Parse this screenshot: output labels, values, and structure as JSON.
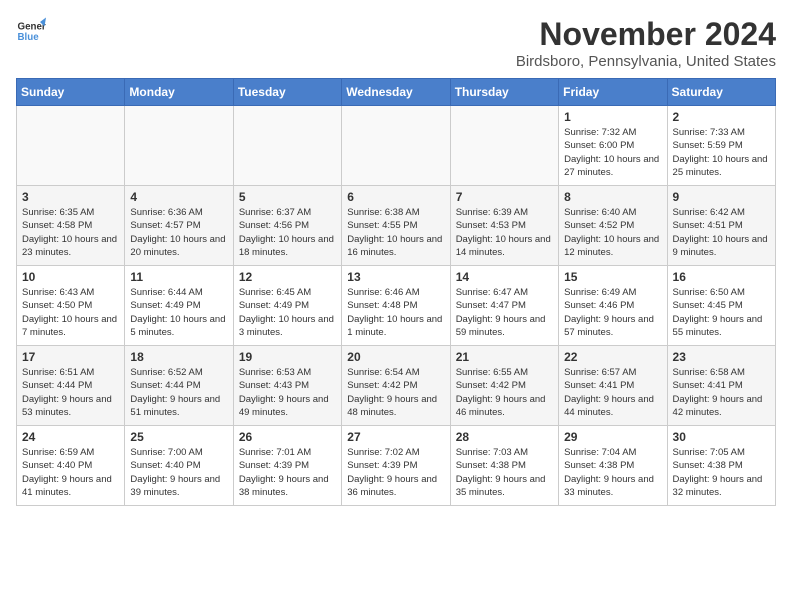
{
  "header": {
    "logo_line1": "General",
    "logo_line2": "Blue",
    "month_title": "November 2024",
    "location": "Birdsboro, Pennsylvania, United States"
  },
  "days_of_week": [
    "Sunday",
    "Monday",
    "Tuesday",
    "Wednesday",
    "Thursday",
    "Friday",
    "Saturday"
  ],
  "weeks": [
    [
      {
        "day": "",
        "info": ""
      },
      {
        "day": "",
        "info": ""
      },
      {
        "day": "",
        "info": ""
      },
      {
        "day": "",
        "info": ""
      },
      {
        "day": "",
        "info": ""
      },
      {
        "day": "1",
        "info": "Sunrise: 7:32 AM\nSunset: 6:00 PM\nDaylight: 10 hours and 27 minutes."
      },
      {
        "day": "2",
        "info": "Sunrise: 7:33 AM\nSunset: 5:59 PM\nDaylight: 10 hours and 25 minutes."
      }
    ],
    [
      {
        "day": "3",
        "info": "Sunrise: 6:35 AM\nSunset: 4:58 PM\nDaylight: 10 hours and 23 minutes."
      },
      {
        "day": "4",
        "info": "Sunrise: 6:36 AM\nSunset: 4:57 PM\nDaylight: 10 hours and 20 minutes."
      },
      {
        "day": "5",
        "info": "Sunrise: 6:37 AM\nSunset: 4:56 PM\nDaylight: 10 hours and 18 minutes."
      },
      {
        "day": "6",
        "info": "Sunrise: 6:38 AM\nSunset: 4:55 PM\nDaylight: 10 hours and 16 minutes."
      },
      {
        "day": "7",
        "info": "Sunrise: 6:39 AM\nSunset: 4:53 PM\nDaylight: 10 hours and 14 minutes."
      },
      {
        "day": "8",
        "info": "Sunrise: 6:40 AM\nSunset: 4:52 PM\nDaylight: 10 hours and 12 minutes."
      },
      {
        "day": "9",
        "info": "Sunrise: 6:42 AM\nSunset: 4:51 PM\nDaylight: 10 hours and 9 minutes."
      }
    ],
    [
      {
        "day": "10",
        "info": "Sunrise: 6:43 AM\nSunset: 4:50 PM\nDaylight: 10 hours and 7 minutes."
      },
      {
        "day": "11",
        "info": "Sunrise: 6:44 AM\nSunset: 4:49 PM\nDaylight: 10 hours and 5 minutes."
      },
      {
        "day": "12",
        "info": "Sunrise: 6:45 AM\nSunset: 4:49 PM\nDaylight: 10 hours and 3 minutes."
      },
      {
        "day": "13",
        "info": "Sunrise: 6:46 AM\nSunset: 4:48 PM\nDaylight: 10 hours and 1 minute."
      },
      {
        "day": "14",
        "info": "Sunrise: 6:47 AM\nSunset: 4:47 PM\nDaylight: 9 hours and 59 minutes."
      },
      {
        "day": "15",
        "info": "Sunrise: 6:49 AM\nSunset: 4:46 PM\nDaylight: 9 hours and 57 minutes."
      },
      {
        "day": "16",
        "info": "Sunrise: 6:50 AM\nSunset: 4:45 PM\nDaylight: 9 hours and 55 minutes."
      }
    ],
    [
      {
        "day": "17",
        "info": "Sunrise: 6:51 AM\nSunset: 4:44 PM\nDaylight: 9 hours and 53 minutes."
      },
      {
        "day": "18",
        "info": "Sunrise: 6:52 AM\nSunset: 4:44 PM\nDaylight: 9 hours and 51 minutes."
      },
      {
        "day": "19",
        "info": "Sunrise: 6:53 AM\nSunset: 4:43 PM\nDaylight: 9 hours and 49 minutes."
      },
      {
        "day": "20",
        "info": "Sunrise: 6:54 AM\nSunset: 4:42 PM\nDaylight: 9 hours and 48 minutes."
      },
      {
        "day": "21",
        "info": "Sunrise: 6:55 AM\nSunset: 4:42 PM\nDaylight: 9 hours and 46 minutes."
      },
      {
        "day": "22",
        "info": "Sunrise: 6:57 AM\nSunset: 4:41 PM\nDaylight: 9 hours and 44 minutes."
      },
      {
        "day": "23",
        "info": "Sunrise: 6:58 AM\nSunset: 4:41 PM\nDaylight: 9 hours and 42 minutes."
      }
    ],
    [
      {
        "day": "24",
        "info": "Sunrise: 6:59 AM\nSunset: 4:40 PM\nDaylight: 9 hours and 41 minutes."
      },
      {
        "day": "25",
        "info": "Sunrise: 7:00 AM\nSunset: 4:40 PM\nDaylight: 9 hours and 39 minutes."
      },
      {
        "day": "26",
        "info": "Sunrise: 7:01 AM\nSunset: 4:39 PM\nDaylight: 9 hours and 38 minutes."
      },
      {
        "day": "27",
        "info": "Sunrise: 7:02 AM\nSunset: 4:39 PM\nDaylight: 9 hours and 36 minutes."
      },
      {
        "day": "28",
        "info": "Sunrise: 7:03 AM\nSunset: 4:38 PM\nDaylight: 9 hours and 35 minutes."
      },
      {
        "day": "29",
        "info": "Sunrise: 7:04 AM\nSunset: 4:38 PM\nDaylight: 9 hours and 33 minutes."
      },
      {
        "day": "30",
        "info": "Sunrise: 7:05 AM\nSunset: 4:38 PM\nDaylight: 9 hours and 32 minutes."
      }
    ]
  ]
}
